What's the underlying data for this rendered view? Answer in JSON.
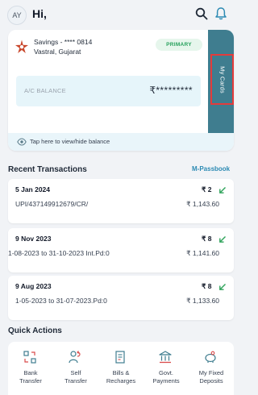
{
  "header": {
    "avatar_initials": "AY",
    "greeting": "Hi,"
  },
  "account": {
    "type_masked": "Savings - **** 0814",
    "branch": "Vastral, Gujarat",
    "badge": "PRIMARY",
    "balance_label": "A/C BALANCE",
    "balance_masked": "₹*********",
    "my_cards_label": "My Cards",
    "toggle_text": "Tap here to view/hide balance"
  },
  "recent": {
    "title": "Recent Transactions",
    "link": "M-Passbook",
    "transactions": [
      {
        "date": "5 Jan 2024",
        "desc": "UPI/437149912679/CR/",
        "amount": "₹ 2",
        "balance": "₹ 1,143.60"
      },
      {
        "date": "9 Nov 2023",
        "desc": "1-08-2023 to 31-10-2023 Int.Pd:0",
        "amount": "₹ 8",
        "balance": "₹ 1,141.60"
      },
      {
        "date": "9 Aug 2023",
        "desc": "1-05-2023 to 31-07-2023.Pd:0",
        "amount": "₹ 8",
        "balance": "₹ 1,133.60"
      }
    ]
  },
  "quick": {
    "title": "Quick Actions",
    "items": [
      {
        "label1": "Bank",
        "label2": "Transfer",
        "icon": "bank-transfer-icon"
      },
      {
        "label1": "Self",
        "label2": "Transfer",
        "icon": "self-transfer-icon"
      },
      {
        "label1": "Bills &",
        "label2": "Recharges",
        "icon": "bills-icon"
      },
      {
        "label1": "Govt.",
        "label2": "Payments",
        "icon": "govt-payments-icon"
      },
      {
        "label1": "My Fixed",
        "label2": "Deposits",
        "icon": "fixed-deposits-icon"
      }
    ]
  },
  "colors": {
    "accent": "#2c8ab3",
    "strip": "#3f7d8f",
    "credit": "#2fa35b",
    "highlight": "#e43b3b"
  }
}
